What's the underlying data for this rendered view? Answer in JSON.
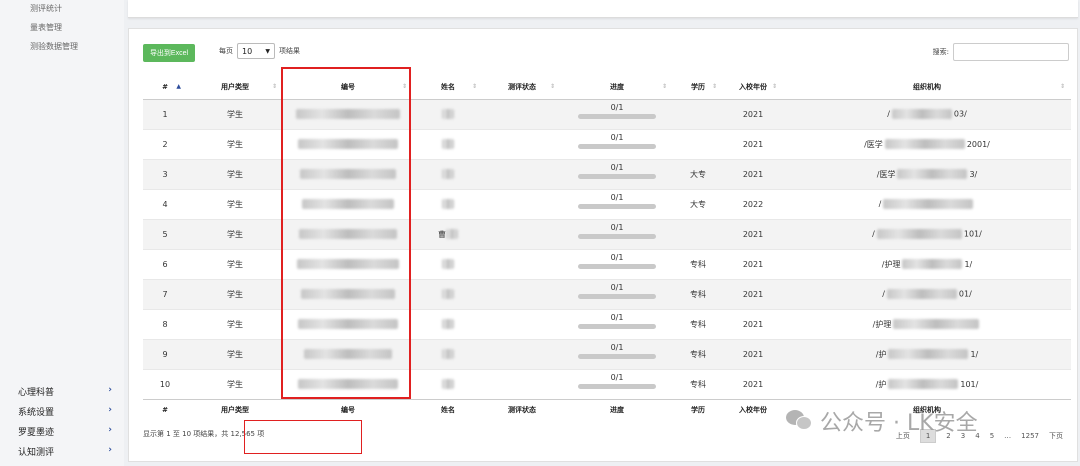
{
  "sidebar": {
    "sub_items": [
      "测评统计",
      "量表管理",
      "测验数据管理"
    ],
    "main_items": [
      "心理科普",
      "系统设置",
      "罗夏墨迹",
      "认知测评"
    ]
  },
  "toolbar": {
    "export_label": "导出到Excel",
    "per_page_prefix": "每页",
    "per_page_value": "10",
    "per_page_suffix": "项结果",
    "search_label": "搜索:"
  },
  "table": {
    "columns": [
      "#",
      "用户类型",
      "编号",
      "姓名",
      "测评状态",
      "进度",
      "学历",
      "入校年份",
      "组织机构"
    ],
    "rows": [
      {
        "no": "1",
        "type": "学生",
        "name": "",
        "status": "",
        "progress": "0/1",
        "edu": "",
        "year": "2021",
        "org_start": "/",
        "org_end": "03/"
      },
      {
        "no": "2",
        "type": "学生",
        "name": "",
        "status": "",
        "progress": "0/1",
        "edu": "",
        "year": "2021",
        "org_start": "/医学",
        "org_end": "2001/"
      },
      {
        "no": "3",
        "type": "学生",
        "name": "",
        "status": "",
        "progress": "0/1",
        "edu": "大专",
        "year": "2021",
        "org_start": "/医学",
        "org_end": "3/"
      },
      {
        "no": "4",
        "type": "学生",
        "name": "",
        "status": "",
        "progress": "0/1",
        "edu": "大专",
        "year": "2022",
        "org_start": "/",
        "org_end": ""
      },
      {
        "no": "5",
        "type": "学生",
        "name": "曹",
        "status": "",
        "progress": "0/1",
        "edu": "",
        "year": "2021",
        "org_start": "/",
        "org_end": "101/"
      },
      {
        "no": "6",
        "type": "学生",
        "name": "",
        "status": "",
        "progress": "0/1",
        "edu": "专科",
        "year": "2021",
        "org_start": "/护理",
        "org_end": "1/"
      },
      {
        "no": "7",
        "type": "学生",
        "name": "",
        "status": "",
        "progress": "0/1",
        "edu": "专科",
        "year": "2021",
        "org_start": "/",
        "org_end": "01/"
      },
      {
        "no": "8",
        "type": "学生",
        "name": "",
        "status": "",
        "progress": "0/1",
        "edu": "专科",
        "year": "2021",
        "org_start": "/护理",
        "org_end": ""
      },
      {
        "no": "9",
        "type": "学生",
        "name": "",
        "status": "",
        "progress": "0/1",
        "edu": "专科",
        "year": "2021",
        "org_start": "/护",
        "org_end": "1/"
      },
      {
        "no": "10",
        "type": "学生",
        "name": "",
        "status": "",
        "progress": "0/1",
        "edu": "专科",
        "year": "2021",
        "org_start": "/护",
        "org_end": "101/"
      }
    ]
  },
  "footer": {
    "info": "显示第 1 至 10 项结果，共 12,565 项",
    "pager": [
      "上页",
      "1",
      "2",
      "3",
      "4",
      "5",
      "…",
      "1257",
      "下页"
    ]
  },
  "watermark": "公众号 · LK安全",
  "colors": {
    "export_button": "#5cb85c",
    "highlight_border": "#e02020"
  }
}
